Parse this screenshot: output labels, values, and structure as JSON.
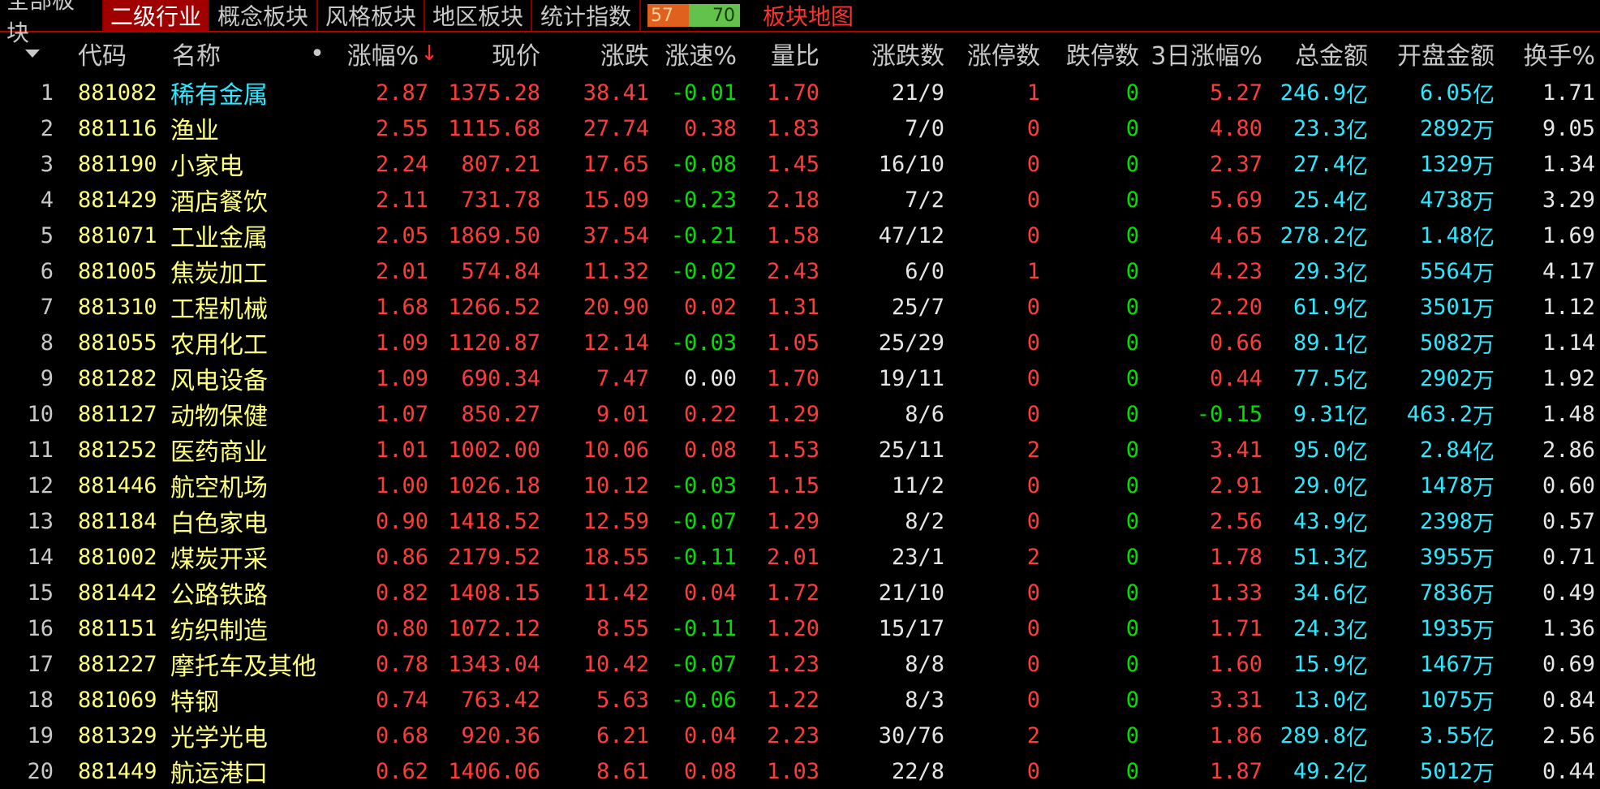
{
  "tabs": [
    {
      "label": "全部板块",
      "active": false
    },
    {
      "label": "二级行业",
      "active": true
    },
    {
      "label": "概念板块",
      "active": false
    },
    {
      "label": "风格板块",
      "active": false
    },
    {
      "label": "地区板块",
      "active": false
    },
    {
      "label": "统计指数",
      "active": false
    }
  ],
  "breadth": {
    "up": "57",
    "down": "70",
    "up_fraction": 0.45,
    "up_color": "#e0601e",
    "down_color": "#62c24c"
  },
  "map_label": "板块地图",
  "columns": {
    "menu": "",
    "code": "代码",
    "name": "名称",
    "dot": "•",
    "chg_pct": "涨幅%",
    "sort_mark": "↓",
    "price": "现价",
    "chg": "涨跌",
    "speed": "涨速%",
    "vol_ratio": "量比",
    "updown": "涨跌数",
    "limit_up": "涨停数",
    "limit_down": "跌停数",
    "chg3d": "3日涨幅%",
    "amount": "总金额",
    "open_amount": "开盘金额",
    "turnover": "换手%"
  },
  "rows": [
    {
      "idx": "1",
      "code": "881082",
      "name": "稀有金属",
      "chg_pct": "2.87",
      "price": "1375.28",
      "chg": "38.41",
      "speed": "-0.01",
      "vol_ratio": "1.70",
      "updown": "21/9",
      "limit_up": "1",
      "limit_down": "0",
      "chg3d": "5.27",
      "amount": "246.9",
      "amount_unit": "亿",
      "open_amount": "6.05",
      "open_unit": "亿",
      "turnover": "1.71"
    },
    {
      "idx": "2",
      "code": "881116",
      "name": "渔业",
      "chg_pct": "2.55",
      "price": "1115.68",
      "chg": "27.74",
      "speed": "0.38",
      "vol_ratio": "1.83",
      "updown": "7/0",
      "limit_up": "0",
      "limit_down": "0",
      "chg3d": "4.80",
      "amount": "23.3",
      "amount_unit": "亿",
      "open_amount": "2892",
      "open_unit": "万",
      "turnover": "9.05"
    },
    {
      "idx": "3",
      "code": "881190",
      "name": "小家电",
      "chg_pct": "2.24",
      "price": "807.21",
      "chg": "17.65",
      "speed": "-0.08",
      "vol_ratio": "1.45",
      "updown": "16/10",
      "limit_up": "0",
      "limit_down": "0",
      "chg3d": "2.37",
      "amount": "27.4",
      "amount_unit": "亿",
      "open_amount": "1329",
      "open_unit": "万",
      "turnover": "1.34"
    },
    {
      "idx": "4",
      "code": "881429",
      "name": "酒店餐饮",
      "chg_pct": "2.11",
      "price": "731.78",
      "chg": "15.09",
      "speed": "-0.23",
      "vol_ratio": "2.18",
      "updown": "7/2",
      "limit_up": "0",
      "limit_down": "0",
      "chg3d": "5.69",
      "amount": "25.4",
      "amount_unit": "亿",
      "open_amount": "4738",
      "open_unit": "万",
      "turnover": "3.29"
    },
    {
      "idx": "5",
      "code": "881071",
      "name": "工业金属",
      "chg_pct": "2.05",
      "price": "1869.50",
      "chg": "37.54",
      "speed": "-0.21",
      "vol_ratio": "1.58",
      "updown": "47/12",
      "limit_up": "0",
      "limit_down": "0",
      "chg3d": "4.65",
      "amount": "278.2",
      "amount_unit": "亿",
      "open_amount": "1.48",
      "open_unit": "亿",
      "turnover": "1.69"
    },
    {
      "idx": "6",
      "code": "881005",
      "name": "焦炭加工",
      "chg_pct": "2.01",
      "price": "574.84",
      "chg": "11.32",
      "speed": "-0.02",
      "vol_ratio": "2.43",
      "updown": "6/0",
      "limit_up": "1",
      "limit_down": "0",
      "chg3d": "4.23",
      "amount": "29.3",
      "amount_unit": "亿",
      "open_amount": "5564",
      "open_unit": "万",
      "turnover": "4.17"
    },
    {
      "idx": "7",
      "code": "881310",
      "name": "工程机械",
      "chg_pct": "1.68",
      "price": "1266.52",
      "chg": "20.90",
      "speed": "0.02",
      "vol_ratio": "1.31",
      "updown": "25/7",
      "limit_up": "0",
      "limit_down": "0",
      "chg3d": "2.20",
      "amount": "61.9",
      "amount_unit": "亿",
      "open_amount": "3501",
      "open_unit": "万",
      "turnover": "1.12"
    },
    {
      "idx": "8",
      "code": "881055",
      "name": "农用化工",
      "chg_pct": "1.09",
      "price": "1120.87",
      "chg": "12.14",
      "speed": "-0.03",
      "vol_ratio": "1.05",
      "updown": "25/29",
      "limit_up": "0",
      "limit_down": "0",
      "chg3d": "0.66",
      "amount": "89.1",
      "amount_unit": "亿",
      "open_amount": "5082",
      "open_unit": "万",
      "turnover": "1.14"
    },
    {
      "idx": "9",
      "code": "881282",
      "name": "风电设备",
      "chg_pct": "1.09",
      "price": "690.34",
      "chg": "7.47",
      "speed": "0.00",
      "vol_ratio": "1.70",
      "updown": "19/11",
      "limit_up": "0",
      "limit_down": "0",
      "chg3d": "0.44",
      "amount": "77.5",
      "amount_unit": "亿",
      "open_amount": "2902",
      "open_unit": "万",
      "turnover": "1.92"
    },
    {
      "idx": "10",
      "code": "881127",
      "name": "动物保健",
      "chg_pct": "1.07",
      "price": "850.27",
      "chg": "9.01",
      "speed": "0.22",
      "vol_ratio": "1.29",
      "updown": "8/6",
      "limit_up": "0",
      "limit_down": "0",
      "chg3d": "-0.15",
      "amount": "9.31",
      "amount_unit": "亿",
      "open_amount": "463.2",
      "open_unit": "万",
      "turnover": "1.48"
    },
    {
      "idx": "11",
      "code": "881252",
      "name": "医药商业",
      "chg_pct": "1.01",
      "price": "1002.00",
      "chg": "10.06",
      "speed": "0.08",
      "vol_ratio": "1.53",
      "updown": "25/11",
      "limit_up": "2",
      "limit_down": "0",
      "chg3d": "3.41",
      "amount": "95.0",
      "amount_unit": "亿",
      "open_amount": "2.84",
      "open_unit": "亿",
      "turnover": "2.86"
    },
    {
      "idx": "12",
      "code": "881446",
      "name": "航空机场",
      "chg_pct": "1.00",
      "price": "1026.18",
      "chg": "10.12",
      "speed": "-0.03",
      "vol_ratio": "1.15",
      "updown": "11/2",
      "limit_up": "0",
      "limit_down": "0",
      "chg3d": "2.91",
      "amount": "29.0",
      "amount_unit": "亿",
      "open_amount": "1478",
      "open_unit": "万",
      "turnover": "0.60"
    },
    {
      "idx": "13",
      "code": "881184",
      "name": "白色家电",
      "chg_pct": "0.90",
      "price": "1418.52",
      "chg": "12.59",
      "speed": "-0.07",
      "vol_ratio": "1.29",
      "updown": "8/2",
      "limit_up": "0",
      "limit_down": "0",
      "chg3d": "2.56",
      "amount": "43.9",
      "amount_unit": "亿",
      "open_amount": "2398",
      "open_unit": "万",
      "turnover": "0.57"
    },
    {
      "idx": "14",
      "code": "881002",
      "name": "煤炭开采",
      "chg_pct": "0.86",
      "price": "2179.52",
      "chg": "18.55",
      "speed": "-0.11",
      "vol_ratio": "2.01",
      "updown": "23/1",
      "limit_up": "2",
      "limit_down": "0",
      "chg3d": "1.78",
      "amount": "51.3",
      "amount_unit": "亿",
      "open_amount": "3955",
      "open_unit": "万",
      "turnover": "0.71"
    },
    {
      "idx": "15",
      "code": "881442",
      "name": "公路铁路",
      "chg_pct": "0.82",
      "price": "1408.15",
      "chg": "11.42",
      "speed": "0.04",
      "vol_ratio": "1.72",
      "updown": "21/10",
      "limit_up": "0",
      "limit_down": "0",
      "chg3d": "1.33",
      "amount": "34.6",
      "amount_unit": "亿",
      "open_amount": "7836",
      "open_unit": "万",
      "turnover": "0.49"
    },
    {
      "idx": "16",
      "code": "881151",
      "name": "纺织制造",
      "chg_pct": "0.80",
      "price": "1072.12",
      "chg": "8.55",
      "speed": "-0.11",
      "vol_ratio": "1.20",
      "updown": "15/17",
      "limit_up": "0",
      "limit_down": "0",
      "chg3d": "1.71",
      "amount": "24.3",
      "amount_unit": "亿",
      "open_amount": "1935",
      "open_unit": "万",
      "turnover": "1.36"
    },
    {
      "idx": "17",
      "code": "881227",
      "name": "摩托车及其他",
      "chg_pct": "0.78",
      "price": "1343.04",
      "chg": "10.42",
      "speed": "-0.07",
      "vol_ratio": "1.23",
      "updown": "8/8",
      "limit_up": "0",
      "limit_down": "0",
      "chg3d": "1.60",
      "amount": "15.9",
      "amount_unit": "亿",
      "open_amount": "1467",
      "open_unit": "万",
      "turnover": "0.69"
    },
    {
      "idx": "18",
      "code": "881069",
      "name": "特钢",
      "chg_pct": "0.74",
      "price": "763.42",
      "chg": "5.63",
      "speed": "-0.06",
      "vol_ratio": "1.22",
      "updown": "8/3",
      "limit_up": "0",
      "limit_down": "0",
      "chg3d": "3.31",
      "amount": "13.0",
      "amount_unit": "亿",
      "open_amount": "1075",
      "open_unit": "万",
      "turnover": "0.84"
    },
    {
      "idx": "19",
      "code": "881329",
      "name": "光学光电",
      "chg_pct": "0.68",
      "price": "920.36",
      "chg": "6.21",
      "speed": "0.04",
      "vol_ratio": "2.23",
      "updown": "30/76",
      "limit_up": "2",
      "limit_down": "0",
      "chg3d": "1.86",
      "amount": "289.8",
      "amount_unit": "亿",
      "open_amount": "3.55",
      "open_unit": "亿",
      "turnover": "2.56"
    },
    {
      "idx": "20",
      "code": "881449",
      "name": "航运港口",
      "chg_pct": "0.62",
      "price": "1406.06",
      "chg": "8.61",
      "speed": "0.08",
      "vol_ratio": "1.03",
      "updown": "22/8",
      "limit_up": "0",
      "limit_down": "0",
      "chg3d": "1.87",
      "amount": "49.2",
      "amount_unit": "亿",
      "open_amount": "5012",
      "open_unit": "万",
      "turnover": "0.44"
    }
  ],
  "selected_row": 0
}
